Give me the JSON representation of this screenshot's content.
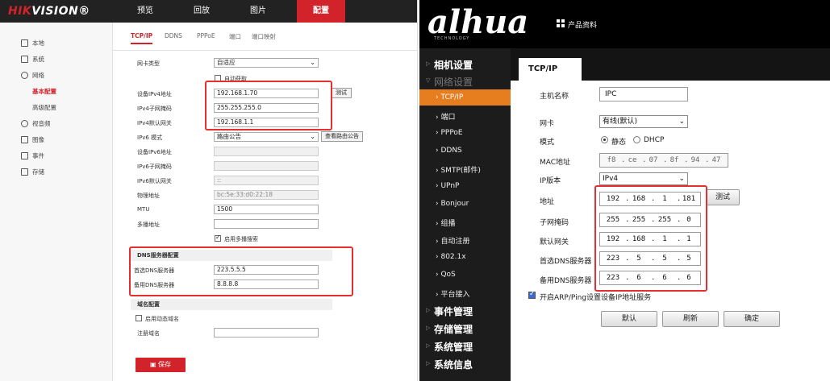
{
  "hik": {
    "logo_prefix": "HIK",
    "logo_rest": "VISION®",
    "nav": [
      "预览",
      "回放",
      "图片",
      "配置"
    ],
    "sidebar": [
      "本地",
      "系统",
      "网络",
      "基本配置",
      "高级配置",
      "视音频",
      "图像",
      "事件",
      "存储"
    ],
    "tabs": [
      "TCP/IP",
      "DDNS",
      "PPPoE",
      "端口",
      "端口映射"
    ],
    "nic_type_label": "网卡类型",
    "nic_type_value": "自适应",
    "dhcp_label": "自动获取",
    "ipv4_addr_label": "设备IPv4地址",
    "ipv4_addr_value": "192.168.1.70",
    "test_button": "测试",
    "ipv4_mask_label": "IPv4子网掩码",
    "ipv4_mask_value": "255.255.255.0",
    "ipv4_gw_label": "IPv4默认网关",
    "ipv4_gw_value": "192.168.1.1",
    "ipv6_mode_label": "IPv6 模式",
    "ipv6_mode_value": "路由公告",
    "route_button": "查看路由公告",
    "ipv6_addr_label": "设备IPv6地址",
    "ipv6_mask_label": "IPv6子网掩码",
    "ipv6_gw_label": "IPv6默认网关",
    "ipv6_gw_value": "::",
    "mac_label": "物理地址",
    "mac_value": "bc:5e:33:d0:22:18",
    "mtu_label": "MTU",
    "mtu_value": "1500",
    "multicast_label": "多播地址",
    "multicast_search_label": "启用多播搜索",
    "dns_section": "DNS服务器配置",
    "dns1_label": "首选DNS服务器",
    "dns1_value": "223.5.5.5",
    "dns2_label": "备用DNS服务器",
    "dns2_value": "8.8.8.8",
    "domain_section": "域名配置",
    "dyn_domain_label": "启用动态域名",
    "reg_domain_label": "注册域名",
    "save_button": "保存"
  },
  "dh": {
    "logo": "alhua",
    "logo_sub": "TECHNOLOGY",
    "top_product": "产品资料",
    "tab": "TCP/IP",
    "sidebar_main": [
      "相机设置",
      "网络设置"
    ],
    "sidebar_sub": [
      "TCP/IP",
      "端口",
      "PPPoE",
      "DDNS",
      "SMTP(邮件)",
      "UPnP",
      "Bonjour",
      "组播",
      "自动注册",
      "802.1x",
      "QoS",
      "平台接入"
    ],
    "sidebar_bottom": [
      "事件管理",
      "存储管理",
      "系统管理",
      "系统信息"
    ],
    "hostname_label": "主机名称",
    "hostname_value": "IPC",
    "nic_label": "网卡",
    "nic_value": "有线(默认)",
    "mode_label": "模式",
    "mode_static": "静态",
    "mode_dhcp": "DHCP",
    "mac_label": "MAC地址",
    "mac_parts": [
      "f8",
      "ce",
      "07",
      "8f",
      "94",
      "47"
    ],
    "ipver_label": "IP版本",
    "ipver_value": "IPv4",
    "addr_label": "地址",
    "addr_parts": [
      "192",
      "168",
      "1",
      "181"
    ],
    "test_button": "测试",
    "mask_label": "子网掩码",
    "mask_parts": [
      "255",
      "255",
      "255",
      "0"
    ],
    "gw_label": "默认网关",
    "gw_parts": [
      "192",
      "168",
      "1",
      "1"
    ],
    "dns1_label": "首选DNS服务器",
    "dns1_parts": [
      "223",
      "5",
      "5",
      "5"
    ],
    "dns2_label": "备用DNS服务器",
    "dns2_parts": [
      "223",
      "6",
      "6",
      "6"
    ],
    "arp_label": "开启ARP/Ping设置设备IP地址服务",
    "btn_default": "默认",
    "btn_refresh": "刷新",
    "btn_confirm": "确定"
  },
  "colors": {
    "hik_red": "#d2232a",
    "dahua_orange": "#e67d1e",
    "highlight_red": "#e5302f"
  }
}
